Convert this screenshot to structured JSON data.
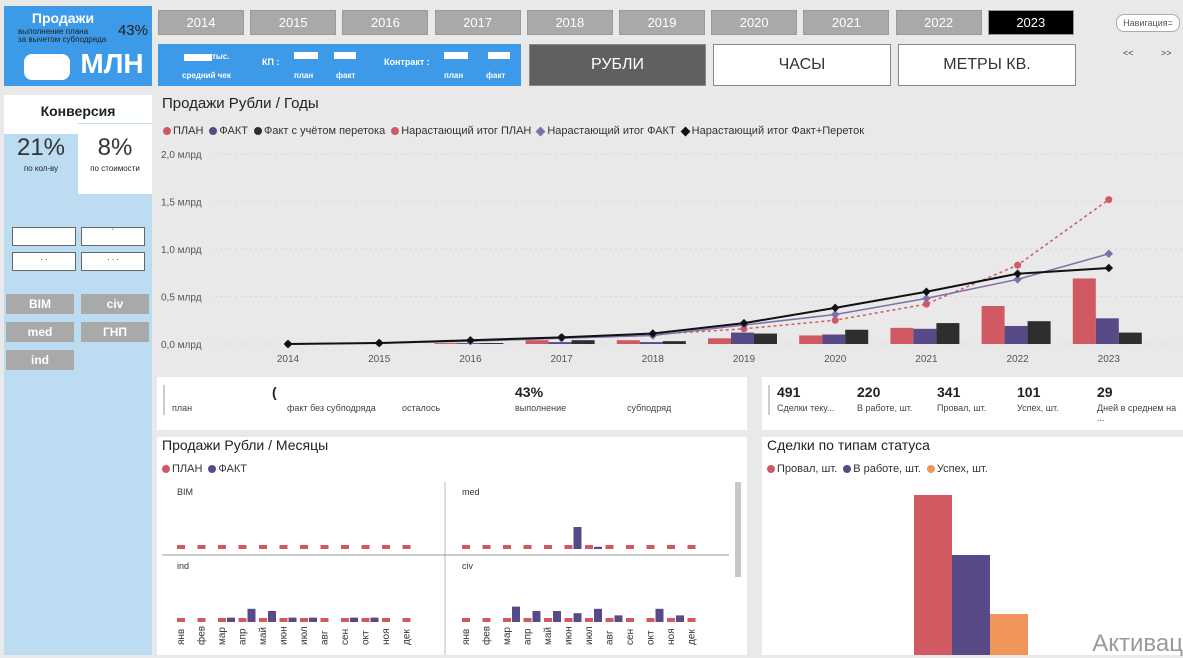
{
  "kpi": {
    "title": "Продажи",
    "percent": "43%",
    "sub1": "выполнение плана",
    "sub2": "за вычетом субподряда",
    "value": "МЛН"
  },
  "years": [
    "2014",
    "2015",
    "2016",
    "2017",
    "2018",
    "2019",
    "2020",
    "2021",
    "2022",
    "2023"
  ],
  "active_year": "2023",
  "nav": {
    "label": "Навигация=",
    "prev": "<<",
    "next": ">>"
  },
  "metrics": {
    "check_unit": "тыс.",
    "check_label": "средний чек",
    "kp": "КП :",
    "contract": "Контракт :",
    "plan": "план",
    "fact": "факт"
  },
  "units": [
    "РУБЛИ",
    "ЧАСЫ",
    "МЕТРЫ КВ."
  ],
  "conversion": {
    "title": "Конверсия",
    "qty_value": "21%",
    "qty_label": "по кол-ву",
    "cost_value": "8%",
    "cost_label": "по стоимости"
  },
  "inputs": [
    " ",
    "`",
    ". .",
    ". . ."
  ],
  "tags": [
    "BIM",
    "civ",
    "med",
    "ГНП",
    "ind"
  ],
  "year_chart": {
    "title": "Продажи Рубли / Годы",
    "legend": [
      {
        "name": "ПЛАН",
        "color": "#d15a62",
        "shape": "dot"
      },
      {
        "name": "ФАКТ",
        "color": "#574a87",
        "shape": "dot"
      },
      {
        "name": "Факт с учётом перетока",
        "color": "#2e2e2e",
        "shape": "dot"
      },
      {
        "name": "Нарастающий итог ПЛАН",
        "color": "#d15a62",
        "shape": "dot"
      },
      {
        "name": "Нарастающий итог ФАКТ",
        "color": "#7c71a8",
        "shape": "diamond"
      },
      {
        "name": "Нарастающий итог Факт+Переток",
        "color": "#111111",
        "shape": "diamond"
      }
    ],
    "yticks": [
      "2,0 млрд",
      "1,5 млрд",
      "1,0 млрд",
      "0,5 млрд",
      "0,0 млрд"
    ]
  },
  "chart_data": {
    "type": "bar",
    "categories": [
      "2014",
      "2015",
      "2016",
      "2017",
      "2018",
      "2019",
      "2020",
      "2021",
      "2022",
      "2023"
    ],
    "ylim": [
      0,
      2.0
    ],
    "ylabel": "",
    "series": [
      {
        "name": "ПЛАН",
        "kind": "bar",
        "values": [
          0.0,
          0.0,
          0.01,
          0.04,
          0.04,
          0.06,
          0.09,
          0.17,
          0.4,
          0.69
        ]
      },
      {
        "name": "ФАКТ",
        "kind": "bar",
        "values": [
          0.0,
          0.0,
          0.01,
          0.02,
          0.02,
          0.12,
          0.1,
          0.16,
          0.19,
          0.27
        ]
      },
      {
        "name": "Факт с учётом перетока",
        "kind": "bar",
        "values": [
          0.0,
          0.0,
          0.01,
          0.04,
          0.03,
          0.11,
          0.15,
          0.22,
          0.24,
          0.12
        ]
      },
      {
        "name": "Нарастающий итог ПЛАН",
        "kind": "line",
        "values": [
          0.0,
          0.01,
          0.03,
          0.07,
          0.1,
          0.16,
          0.25,
          0.42,
          0.83,
          1.52
        ]
      },
      {
        "name": "Нарастающий итог ФАКТ",
        "kind": "line",
        "values": [
          0.0,
          0.01,
          0.03,
          0.06,
          0.09,
          0.2,
          0.31,
          0.48,
          0.68,
          0.95
        ]
      },
      {
        "name": "Нарастающий итог Факт+Переток",
        "kind": "line",
        "values": [
          0.0,
          0.01,
          0.04,
          0.07,
          0.11,
          0.22,
          0.38,
          0.55,
          0.74,
          0.8
        ]
      }
    ]
  },
  "summary": [
    {
      "value": "(",
      "label": "план"
    },
    {
      "value": "",
      "label": "факт без субподряда"
    },
    {
      "value": "",
      "label": "осталось"
    },
    {
      "value": "43%",
      "label": "выполнение"
    },
    {
      "value": "",
      "label": "субподряд"
    }
  ],
  "deals": [
    {
      "value": "491",
      "label": "Сделки теку..."
    },
    {
      "value": "220",
      "label": "В работе, шт."
    },
    {
      "value": "341",
      "label": "Провал, шт."
    },
    {
      "value": "101",
      "label": "Успех, шт."
    },
    {
      "value": "29",
      "label": "Дней в среднем на ..."
    }
  ],
  "month_chart": {
    "title": "Продажи Рубли / Месяцы",
    "legend": [
      {
        "name": "ПЛАН",
        "color": "#d15a62"
      },
      {
        "name": "ФАКТ",
        "color": "#574a87"
      }
    ],
    "panels": [
      "BIM",
      "med",
      "ind",
      "civ"
    ],
    "months": [
      "янв",
      "фев",
      "мар",
      "апр",
      "май",
      "июн",
      "июл",
      "авг",
      "сен",
      "окт",
      "ноя",
      "дек"
    ]
  },
  "status_chart": {
    "title": "Сделки по типам статуса",
    "legend": [
      {
        "name": "Провал, шт.",
        "color": "#d15a62"
      },
      {
        "name": "В работе, шт.",
        "color": "#574a87"
      },
      {
        "name": "Успех, шт.",
        "color": "#f0955a"
      }
    ]
  },
  "watermark": "Активац"
}
